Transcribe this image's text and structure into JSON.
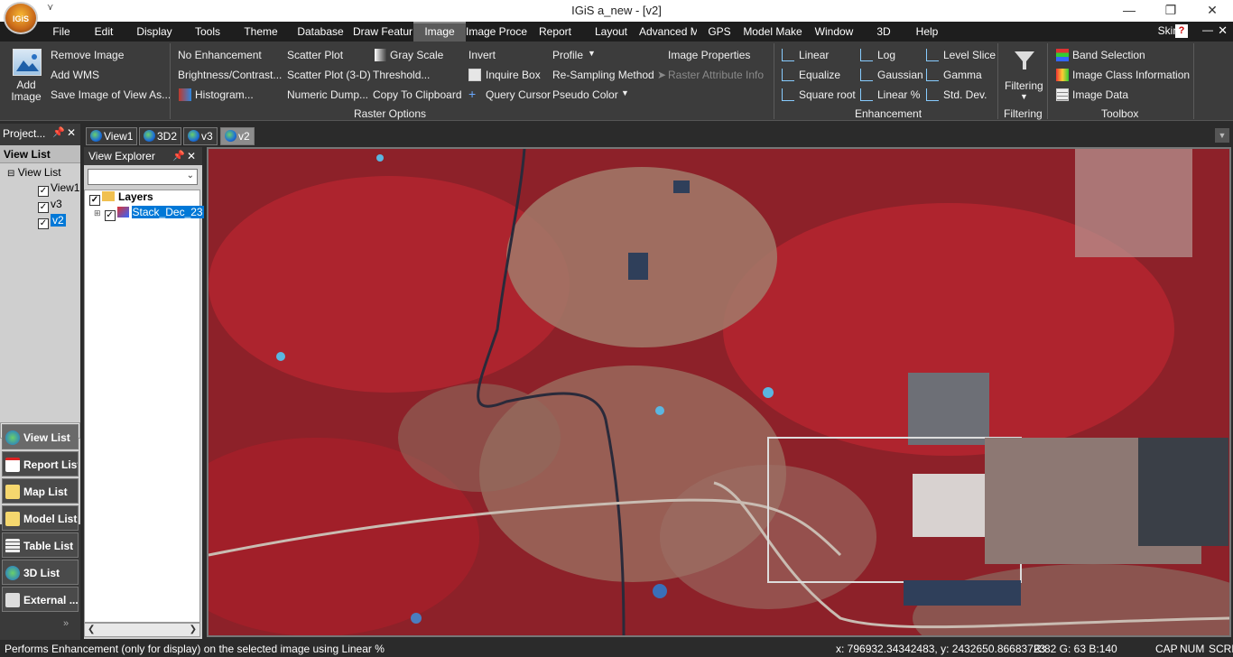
{
  "window": {
    "title": "IGiS a_new - [v2]",
    "logo_text": "IGiS",
    "quick_access": "⋎"
  },
  "menu": [
    "File",
    "Edit",
    "Display",
    "Tools",
    "Theme",
    "Database",
    "Draw Featur",
    "Image",
    "Image Proce",
    "Report",
    "Layout",
    "Advanced M",
    "GPS",
    "Model Make",
    "Window",
    "3D",
    "Help"
  ],
  "skin": "Skin",
  "help": "?",
  "ribbon": {
    "add_image": "Add Image",
    "col1": [
      "Remove Image",
      "Add WMS",
      "Save Image of View As..."
    ],
    "col2": [
      "No Enhancement",
      "Brightness/Contrast...",
      "Histogram..."
    ],
    "col3": [
      "Scatter Plot",
      "Scatter Plot (3-D)",
      "Numeric Dump..."
    ],
    "col4": [
      "Gray Scale",
      "Threshold...",
      "Copy To Clipboard"
    ],
    "col5": [
      "Invert",
      "Inquire Box",
      "Query Cursor"
    ],
    "col6": [
      "Profile",
      "Re-Sampling Method",
      "Pseudo Color"
    ],
    "col7": [
      "Image Properties",
      "Raster Attribute Info"
    ],
    "raster_options": "Raster Options",
    "enh1": [
      "Linear",
      "Equalize",
      "Square root"
    ],
    "enh2": [
      "Log",
      "Gaussian",
      "Linear %"
    ],
    "enh3": [
      "Level Slice",
      "Gamma",
      "Std. Dev."
    ],
    "enhancement": "Enhancement",
    "filtering_btn": "Filtering",
    "filtering": "Filtering",
    "toolbox_items": [
      "Band Selection",
      "Image Class Information",
      "Image Data"
    ],
    "toolbox": "Toolbox"
  },
  "project_panel": {
    "title": "Project...",
    "view_list_header": "View List",
    "tree_root": "View List",
    "views": [
      "View1",
      "v3",
      "v2"
    ],
    "nav": [
      "View List",
      "Report List",
      "Map List",
      "Model List",
      "Table List",
      "3D List",
      "External ..."
    ]
  },
  "tabs": [
    "View1",
    "3D2",
    "v3",
    "v2"
  ],
  "view_explorer": {
    "title": "View Explorer",
    "layers": "Layers",
    "layer_item": "Stack_Dec_23"
  },
  "status": {
    "message": "Performs Enhancement (only for display) on the selected image using Linear %",
    "coords": "x: 796932.34342483,   y: 2432650.86683723",
    "rgb": "R:82 G: 63 B:140",
    "cap": "CAP",
    "num": "NUM",
    "scrl": "SCRL"
  },
  "colors": {
    "accent": "#5b5b5b",
    "vegetation": "#c0192a",
    "background": "#2b2b2b"
  }
}
